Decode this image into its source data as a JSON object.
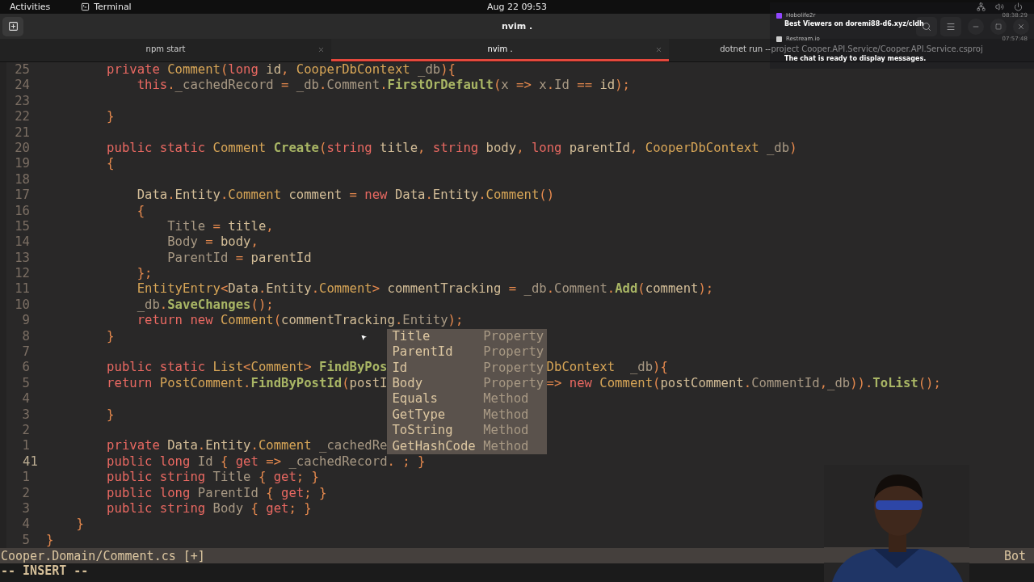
{
  "top_bar": {
    "activities": "Activities",
    "app": "Terminal",
    "clock": "Aug 22  09:53"
  },
  "window": {
    "title": "nvim ."
  },
  "tabs": [
    {
      "label": "npm start",
      "selected": false,
      "closable": true
    },
    {
      "label": "nvim .",
      "selected": true,
      "closable": true
    },
    {
      "label": "dotnet run --project Cooper.API.Service/Cooper.API.Service.csproj",
      "selected": false,
      "closable": false
    }
  ],
  "editor": {
    "lines": [
      {
        "number": "25",
        "current": false,
        "tokens": [
          {
            "kind": "keyword",
            "text": "        private"
          },
          {
            "kind": "type",
            "text": " Comment"
          },
          {
            "kind": "punct",
            "text": "("
          },
          {
            "kind": "keyword",
            "text": "long"
          },
          {
            "kind": "plain",
            "text": " id"
          },
          {
            "kind": "punct",
            "text": ", "
          },
          {
            "kind": "type",
            "text": "CooperDbContext"
          },
          {
            "kind": "member",
            "text": " _db"
          },
          {
            "kind": "punct",
            "text": "){"
          }
        ]
      },
      {
        "number": "24",
        "current": false,
        "tokens": [
          {
            "kind": "keyword",
            "text": "            this"
          },
          {
            "kind": "punct",
            "text": "."
          },
          {
            "kind": "member",
            "text": "_cachedRecord"
          },
          {
            "kind": "punct",
            "text": " = "
          },
          {
            "kind": "member",
            "text": "_db"
          },
          {
            "kind": "punct",
            "text": "."
          },
          {
            "kind": "member",
            "text": "Comment"
          },
          {
            "kind": "punct",
            "text": "."
          },
          {
            "kind": "function",
            "text": "FirstOrDefault"
          },
          {
            "kind": "punct",
            "text": "("
          },
          {
            "kind": "member",
            "text": "x"
          },
          {
            "kind": "punct",
            "text": " => "
          },
          {
            "kind": "member",
            "text": "x"
          },
          {
            "kind": "punct",
            "text": "."
          },
          {
            "kind": "member",
            "text": "Id"
          },
          {
            "kind": "punct",
            "text": " == "
          },
          {
            "kind": "plain",
            "text": "id"
          },
          {
            "kind": "punct",
            "text": ");"
          }
        ]
      },
      {
        "number": "23",
        "current": false
      },
      {
        "number": "22",
        "current": false,
        "tokens": [
          {
            "kind": "punct",
            "text": "        }"
          }
        ]
      },
      {
        "number": "21",
        "current": false
      },
      {
        "number": "20",
        "current": false,
        "tokens": [
          {
            "kind": "keyword",
            "text": "        public static"
          },
          {
            "kind": "type",
            "text": " Comment"
          },
          {
            "kind": "function",
            "text": " Create"
          },
          {
            "kind": "punct",
            "text": "("
          },
          {
            "kind": "keyword",
            "text": "string"
          },
          {
            "kind": "plain",
            "text": " title"
          },
          {
            "kind": "punct",
            "text": ", "
          },
          {
            "kind": "keyword",
            "text": "string"
          },
          {
            "kind": "plain",
            "text": " body"
          },
          {
            "kind": "punct",
            "text": ", "
          },
          {
            "kind": "keyword",
            "text": "long"
          },
          {
            "kind": "plain",
            "text": " parentId"
          },
          {
            "kind": "punct",
            "text": ", "
          },
          {
            "kind": "type",
            "text": "CooperDbContext"
          },
          {
            "kind": "member",
            "text": " _db"
          },
          {
            "kind": "punct",
            "text": ")"
          }
        ]
      },
      {
        "number": "19",
        "current": false,
        "tokens": [
          {
            "kind": "punct",
            "text": "        {"
          }
        ]
      },
      {
        "number": "18",
        "current": false
      },
      {
        "number": "17",
        "current": false,
        "tokens": [
          {
            "kind": "plain",
            "text": "            Data"
          },
          {
            "kind": "punct",
            "text": "."
          },
          {
            "kind": "plain",
            "text": "Entity"
          },
          {
            "kind": "punct",
            "text": "."
          },
          {
            "kind": "type",
            "text": "Comment"
          },
          {
            "kind": "plain",
            "text": " comment"
          },
          {
            "kind": "punct",
            "text": " = "
          },
          {
            "kind": "keyword",
            "text": "new"
          },
          {
            "kind": "plain",
            "text": " Data"
          },
          {
            "kind": "punct",
            "text": "."
          },
          {
            "kind": "plain",
            "text": "Entity"
          },
          {
            "kind": "punct",
            "text": "."
          },
          {
            "kind": "type",
            "text": "Comment"
          },
          {
            "kind": "punct",
            "text": "()"
          }
        ]
      },
      {
        "number": "16",
        "current": false,
        "tokens": [
          {
            "kind": "punct",
            "text": "            {"
          }
        ]
      },
      {
        "number": "15",
        "current": false,
        "tokens": [
          {
            "kind": "member",
            "text": "                Title"
          },
          {
            "kind": "punct",
            "text": " = "
          },
          {
            "kind": "plain",
            "text": "title"
          },
          {
            "kind": "punct",
            "text": ","
          }
        ]
      },
      {
        "number": "14",
        "current": false,
        "tokens": [
          {
            "kind": "member",
            "text": "                Body"
          },
          {
            "kind": "punct",
            "text": " = "
          },
          {
            "kind": "plain",
            "text": "body"
          },
          {
            "kind": "punct",
            "text": ","
          }
        ]
      },
      {
        "number": "13",
        "current": false,
        "tokens": [
          {
            "kind": "member",
            "text": "                ParentId"
          },
          {
            "kind": "punct",
            "text": " = "
          },
          {
            "kind": "plain",
            "text": "parentId"
          }
        ]
      },
      {
        "number": "12",
        "current": false,
        "tokens": [
          {
            "kind": "punct",
            "text": "            };"
          }
        ]
      },
      {
        "number": "11",
        "current": false,
        "tokens": [
          {
            "kind": "type",
            "text": "            EntityEntry"
          },
          {
            "kind": "punct",
            "text": "<"
          },
          {
            "kind": "plain",
            "text": "Data"
          },
          {
            "kind": "punct",
            "text": "."
          },
          {
            "kind": "plain",
            "text": "Entity"
          },
          {
            "kind": "punct",
            "text": "."
          },
          {
            "kind": "type",
            "text": "Comment"
          },
          {
            "kind": "punct",
            "text": "> "
          },
          {
            "kind": "plain",
            "text": "commentTracking"
          },
          {
            "kind": "punct",
            "text": " = "
          },
          {
            "kind": "member",
            "text": "_db"
          },
          {
            "kind": "punct",
            "text": "."
          },
          {
            "kind": "member",
            "text": "Comment"
          },
          {
            "kind": "punct",
            "text": "."
          },
          {
            "kind": "function",
            "text": "Add"
          },
          {
            "kind": "punct",
            "text": "("
          },
          {
            "kind": "plain",
            "text": "comment"
          },
          {
            "kind": "punct",
            "text": ");"
          }
        ]
      },
      {
        "number": "10",
        "current": false,
        "tokens": [
          {
            "kind": "member",
            "text": "            _db"
          },
          {
            "kind": "punct",
            "text": "."
          },
          {
            "kind": "function",
            "text": "SaveChanges"
          },
          {
            "kind": "punct",
            "text": "();"
          }
        ]
      },
      {
        "number": "9",
        "current": false,
        "tokens": [
          {
            "kind": "keyword",
            "text": "            return new"
          },
          {
            "kind": "type",
            "text": " Comment"
          },
          {
            "kind": "punct",
            "text": "("
          },
          {
            "kind": "plain",
            "text": "commentTracking"
          },
          {
            "kind": "punct",
            "text": "."
          },
          {
            "kind": "member",
            "text": "Entity"
          },
          {
            "kind": "punct",
            "text": ");"
          }
        ]
      },
      {
        "number": "8",
        "current": false,
        "tokens": [
          {
            "kind": "punct",
            "text": "        }"
          }
        ]
      },
      {
        "number": "7",
        "current": false
      },
      {
        "number": "6",
        "current": false,
        "tokens": [
          {
            "kind": "keyword",
            "text": "        public static"
          },
          {
            "kind": "type",
            "text": " List"
          },
          {
            "kind": "punct",
            "text": "<"
          },
          {
            "kind": "type",
            "text": "Comment"
          },
          {
            "kind": "punct",
            "text": "> "
          },
          {
            "kind": "function",
            "text": "FindByPos"
          }
        ],
        "after_menu": [
          {
            "kind": "type",
            "text": "DbContext"
          },
          {
            "kind": "member",
            "text": "  _db"
          },
          {
            "kind": "punct",
            "text": "){"
          }
        ]
      },
      {
        "number": "5",
        "current": false,
        "tokens": [
          {
            "kind": "keyword",
            "text": "        return"
          },
          {
            "kind": "type",
            "text": " PostComment"
          },
          {
            "kind": "punct",
            "text": "."
          },
          {
            "kind": "function",
            "text": "FindByPostId"
          },
          {
            "kind": "punct",
            "text": "("
          },
          {
            "kind": "plain",
            "text": "postI"
          }
        ],
        "after_menu": [
          {
            "kind": "punct",
            "text": "=> "
          },
          {
            "kind": "keyword",
            "text": "new"
          },
          {
            "kind": "type",
            "text": " Comment"
          },
          {
            "kind": "punct",
            "text": "("
          },
          {
            "kind": "plain",
            "text": "postComment"
          },
          {
            "kind": "punct",
            "text": "."
          },
          {
            "kind": "member",
            "text": "CommentId"
          },
          {
            "kind": "punct",
            "text": ","
          },
          {
            "kind": "member",
            "text": "_db"
          },
          {
            "kind": "punct",
            "text": "))."
          },
          {
            "kind": "function",
            "text": "ToList"
          },
          {
            "kind": "punct",
            "text": "();"
          }
        ]
      },
      {
        "number": "4",
        "current": false
      },
      {
        "number": "3",
        "current": false,
        "tokens": [
          {
            "kind": "punct",
            "text": "        }"
          }
        ]
      },
      {
        "number": "2",
        "current": false
      },
      {
        "number": "1",
        "current": false,
        "tokens": [
          {
            "kind": "keyword",
            "text": "        private"
          },
          {
            "kind": "plain",
            "text": " Data"
          },
          {
            "kind": "punct",
            "text": "."
          },
          {
            "kind": "plain",
            "text": "Entity"
          },
          {
            "kind": "punct",
            "text": "."
          },
          {
            "kind": "type",
            "text": "Comment"
          },
          {
            "kind": "member",
            "text": " _cachedRe"
          }
        ]
      },
      {
        "number": "41",
        "current": true,
        "tokens": [
          {
            "kind": "keyword",
            "text": "        public long"
          },
          {
            "kind": "member",
            "text": " Id"
          },
          {
            "kind": "punct",
            "text": " { "
          },
          {
            "kind": "keyword",
            "text": "get"
          },
          {
            "kind": "punct",
            "text": " => "
          },
          {
            "kind": "member",
            "text": "_cachedRecord"
          },
          {
            "kind": "punct",
            "text": ". ; }"
          }
        ]
      },
      {
        "number": "1",
        "current": false,
        "tokens": [
          {
            "kind": "keyword",
            "text": "        public string"
          },
          {
            "kind": "member",
            "text": " Title"
          },
          {
            "kind": "punct",
            "text": " { "
          },
          {
            "kind": "keyword",
            "text": "get"
          },
          {
            "kind": "punct",
            "text": "; }"
          }
        ]
      },
      {
        "number": "2",
        "current": false,
        "tokens": [
          {
            "kind": "keyword",
            "text": "        public long"
          },
          {
            "kind": "member",
            "text": " ParentId"
          },
          {
            "kind": "punct",
            "text": " { "
          },
          {
            "kind": "keyword",
            "text": "get"
          },
          {
            "kind": "punct",
            "text": "; }"
          }
        ]
      },
      {
        "number": "3",
        "current": false,
        "tokens": [
          {
            "kind": "keyword",
            "text": "        public string"
          },
          {
            "kind": "member",
            "text": " Body"
          },
          {
            "kind": "punct",
            "text": " { "
          },
          {
            "kind": "keyword",
            "text": "get"
          },
          {
            "kind": "punct",
            "text": "; }"
          }
        ]
      },
      {
        "number": "4",
        "current": false,
        "tokens": [
          {
            "kind": "punct",
            "text": "    }"
          }
        ]
      },
      {
        "number": "5",
        "current": false,
        "tokens": [
          {
            "kind": "punct",
            "text": "}"
          }
        ]
      }
    ],
    "completion": [
      {
        "label": "Title",
        "kind": "Property"
      },
      {
        "label": "ParentId",
        "kind": "Property"
      },
      {
        "label": "Id",
        "kind": "Property"
      },
      {
        "label": "Body",
        "kind": "Property"
      },
      {
        "label": "Equals",
        "kind": "Method"
      },
      {
        "label": "GetType",
        "kind": "Method"
      },
      {
        "label": "ToString",
        "kind": "Method"
      },
      {
        "label": "GetHashCode",
        "kind": "Method"
      }
    ]
  },
  "status_line": {
    "file": "Cooper.Domain/Comment.cs [+]",
    "position": "Bot"
  },
  "mode": "-- INSERT --",
  "chat_overlay": {
    "messages": [
      {
        "user": "Hobolife2r",
        "time": "08:38:29",
        "text": "Best Viewers on doremi88-d6.xyz/cldh"
      },
      {
        "user": "Restream.io",
        "time": "07:57:48",
        "text": "The chat is ready to display messages."
      }
    ]
  }
}
